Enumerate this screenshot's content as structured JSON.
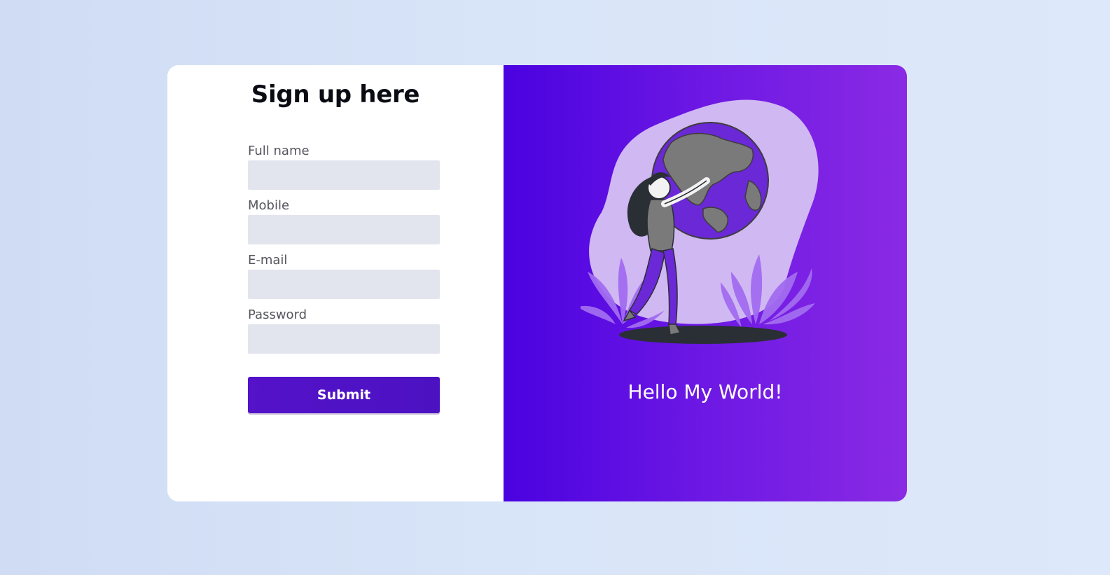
{
  "form": {
    "title": "Sign up here",
    "fields": [
      {
        "label": "Full name",
        "value": "",
        "placeholder": ""
      },
      {
        "label": "Mobile",
        "value": "",
        "placeholder": ""
      },
      {
        "label": "E-mail",
        "value": "",
        "placeholder": ""
      },
      {
        "label": "Password",
        "value": "",
        "placeholder": ""
      }
    ],
    "submit_label": "Submit"
  },
  "hero": {
    "tagline": "Hello My World!",
    "illustration": "woman-hugging-globe-illustration"
  },
  "colors": {
    "accent": "#4c12c2",
    "gradient_start": "#4a02e0",
    "gradient_end": "#8a2ae4",
    "input_bg": "#e2e5ee",
    "page_bg": "#d6e2f6"
  }
}
